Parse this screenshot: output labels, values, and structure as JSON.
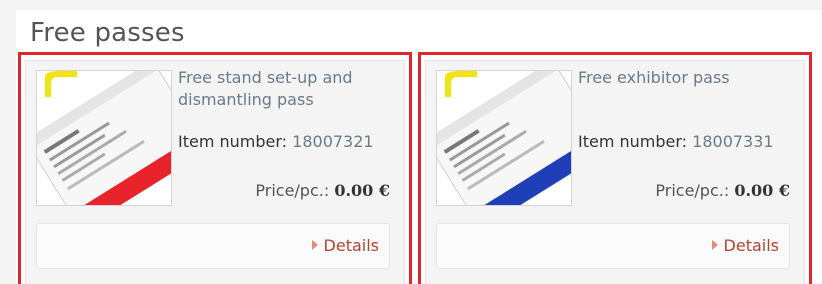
{
  "section": {
    "title": "Free passes"
  },
  "cards": [
    {
      "name": "Free stand set-up and dismantling pass",
      "item_label": "Item number:",
      "item_number": "18007321",
      "price_label": "Price/pc.:",
      "price_value": "0.00 €",
      "details_label": "Details",
      "stripe_color": "#e8232a"
    },
    {
      "name": "Free exhibitor pass",
      "item_label": "Item number:",
      "item_number": "18007331",
      "price_label": "Price/pc.:",
      "price_value": "0.00 €",
      "details_label": "Details",
      "stripe_color": "#1f3fb8"
    }
  ],
  "colors": {
    "highlight_border": "#e0252b",
    "link": "#b5442b",
    "name_text": "#6a7a88"
  }
}
